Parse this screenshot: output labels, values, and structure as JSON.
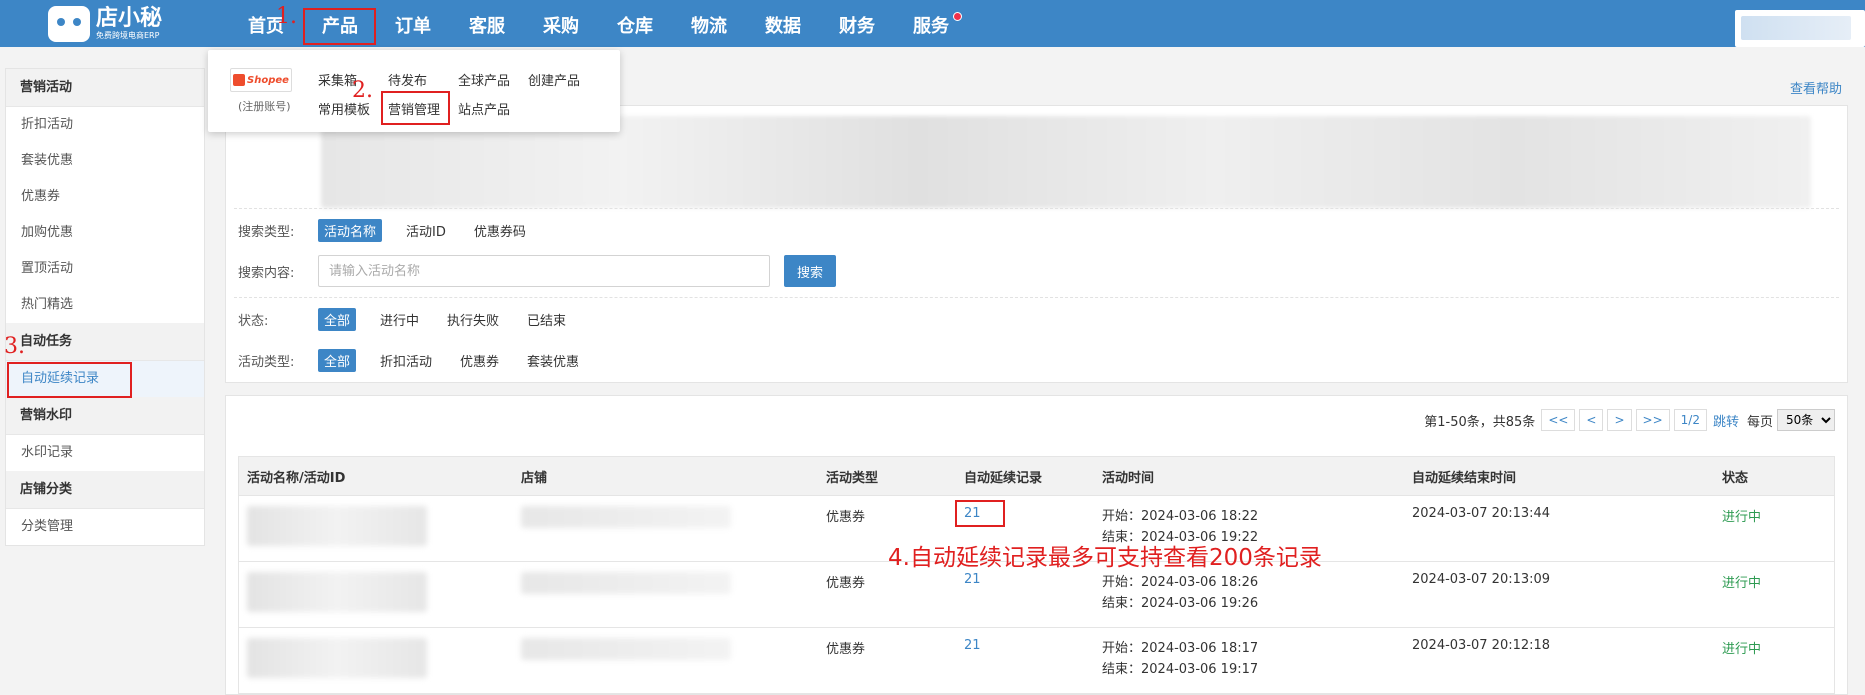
{
  "brand": {
    "name": "店小秘",
    "tagline": "免费跨境电商ERP"
  },
  "nav": [
    {
      "label": "首页"
    },
    {
      "label": "产品"
    },
    {
      "label": "订单"
    },
    {
      "label": "客服"
    },
    {
      "label": "采购"
    },
    {
      "label": "仓库"
    },
    {
      "label": "物流"
    },
    {
      "label": "数据"
    },
    {
      "label": "财务"
    },
    {
      "label": "服务"
    }
  ],
  "dropdown": {
    "platform": "Shopee",
    "platform_note": "(注册账号)",
    "items": [
      "采集箱",
      "待发布",
      "全球产品",
      "创建产品",
      "常用模板",
      "营销管理",
      "站点产品"
    ]
  },
  "annotations": {
    "n1": "1.",
    "n2": "2.",
    "n3": "3.",
    "n4": "4.自动延续记录最多可支持查看200条记录"
  },
  "help": "查看帮助",
  "sidebar": [
    {
      "header": "营销活动",
      "items": [
        "折扣活动",
        "套装优惠",
        "优惠券",
        "加购优惠",
        "置顶活动",
        "热门精选"
      ]
    },
    {
      "header": "自动任务",
      "items": [
        "自动延续记录"
      ]
    },
    {
      "header": "营销水印",
      "items": [
        "水印记录"
      ]
    },
    {
      "header": "店铺分类",
      "items": [
        "分类管理"
      ]
    }
  ],
  "filters": {
    "search_type": {
      "label": "搜索类型:",
      "options": [
        "活动名称",
        "活动ID",
        "优惠券码"
      ]
    },
    "search_content": {
      "label": "搜索内容:",
      "placeholder": "请输入活动名称",
      "button": "搜索"
    },
    "status": {
      "label": "状态:",
      "options": [
        "全部",
        "进行中",
        "执行失败",
        "已结束"
      ]
    },
    "activity_type": {
      "label": "活动类型:",
      "options": [
        "全部",
        "折扣活动",
        "优惠券",
        "套装优惠"
      ]
    }
  },
  "pager": {
    "total": "第1-50条，共85条",
    "buttons": [
      "<<",
      "<",
      ">",
      ">>",
      "1/2"
    ],
    "jump": "跳转",
    "per_page_label": "每页",
    "per_page": "50条"
  },
  "table": {
    "headers": [
      "活动名称/活动ID",
      "店铺",
      "活动类型",
      "自动延续记录",
      "活动时间",
      "自动延续结束时间",
      "状态"
    ],
    "rows": [
      {
        "type": "优惠券",
        "records": "21",
        "start": "开始：2024-03-06 18:22",
        "end": "结束：2024-03-06 19:22",
        "renew_end": "2024-03-07 20:13:44",
        "status": "进行中"
      },
      {
        "type": "优惠券",
        "records": "21",
        "start": "开始：2024-03-06 18:26",
        "end": "结束：2024-03-06 19:26",
        "renew_end": "2024-03-07 20:13:09",
        "status": "进行中"
      },
      {
        "type": "优惠券",
        "records": "21",
        "start": "开始：2024-03-06 18:17",
        "end": "结束：2024-03-06 19:17",
        "renew_end": "2024-03-07 20:12:18",
        "status": "进行中"
      }
    ]
  },
  "colors": {
    "primary": "#3d86c6",
    "annotation": "#e02020",
    "status_running": "#2e9b52"
  }
}
